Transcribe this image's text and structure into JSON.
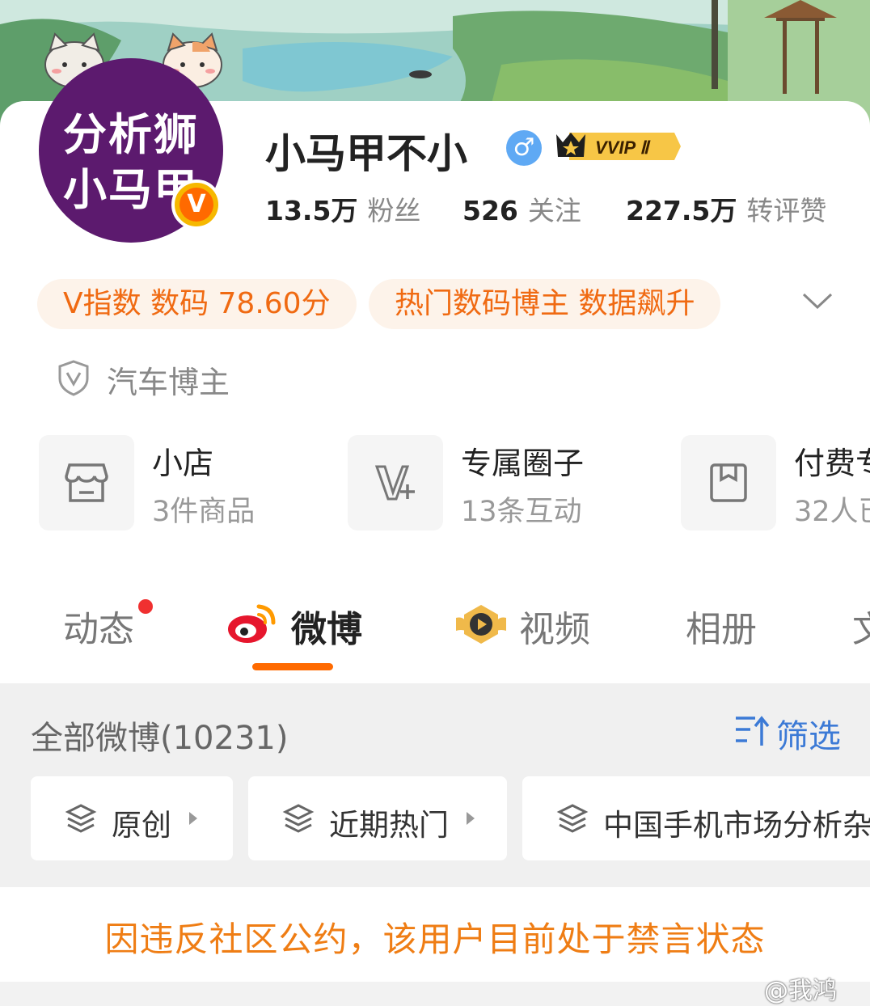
{
  "profile": {
    "name": "小马甲不小",
    "avatar_line1": "分析狮",
    "avatar_line2": "小马甲",
    "verified_badge": "V",
    "gender_symbol": "♂",
    "vip_label": "VVIP Ⅱ"
  },
  "stats": [
    {
      "value": "13.5万",
      "label": "粉丝"
    },
    {
      "value": "526",
      "label": "关注"
    },
    {
      "value": "227.5万",
      "label": "转评赞"
    }
  ],
  "pills": [
    "V指数 数码 78.60分",
    "热门数码博主 数据飙升"
  ],
  "tag": {
    "icon": "shield-v-icon",
    "label": "汽车博主"
  },
  "services": [
    {
      "icon": "store-icon",
      "title": "小店",
      "subtitle": "3件商品"
    },
    {
      "icon": "v-plus-icon",
      "title": "专属圈子",
      "subtitle": "13条互动"
    },
    {
      "icon": "bookmark-box-icon",
      "title": "付费专",
      "subtitle": "32人已"
    }
  ],
  "tabs": [
    "动态",
    "微博",
    "视频",
    "相册",
    "文"
  ],
  "active_tab": "微博",
  "feed": {
    "all_label": "全部微博(10231)",
    "filter_label": "筛选",
    "chips": [
      "原创",
      "近期热门",
      "中国手机市场分析杂"
    ]
  },
  "notice": "因违反社区公约，该用户目前处于禁言状态",
  "watermark": "@我鸿",
  "colors": {
    "accent": "#ff6a00",
    "notice": "#ef7d14",
    "link": "#3c7ad6",
    "avatar_bg": "#5c1a6e"
  }
}
